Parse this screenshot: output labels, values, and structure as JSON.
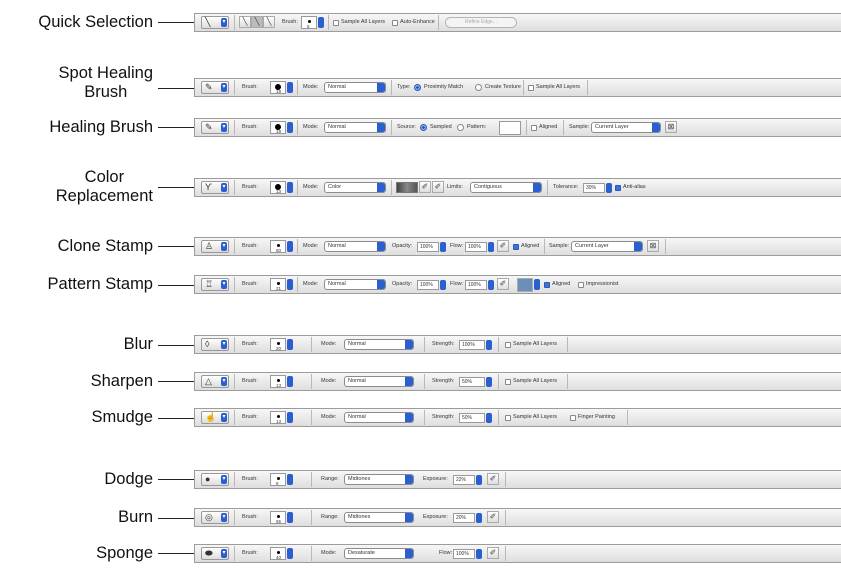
{
  "labels": {
    "quick_selection": "Quick Selection",
    "spot_healing": [
      "Spot Healing",
      "Brush"
    ],
    "healing_brush": "Healing Brush",
    "color_replacement": [
      "Color",
      "Replacement"
    ],
    "clone_stamp": "Clone Stamp",
    "pattern_stamp": "Pattern Stamp",
    "blur": "Blur",
    "sharpen": "Sharpen",
    "smudge": "Smudge",
    "dodge": "Dodge",
    "burn": "Burn",
    "sponge": "Sponge"
  },
  "common": {
    "brush_label": "Brush:",
    "mode_label": "Mode:",
    "sample_all_layers": "Sample All Layers",
    "aligned": "Aligned",
    "sample_label": "Sample:",
    "current_layer": "Current Layer",
    "normal": "Normal"
  },
  "quick_selection": {
    "brush_size": "5",
    "auto_enhance": "Auto-Enhance",
    "refine_edge": "Refine Edge..."
  },
  "spot_healing": {
    "brush_size": "19",
    "type_label": "Type:",
    "proximity_match": "Proximity Match",
    "create_texture": "Create Texture"
  },
  "healing_brush": {
    "brush_size": "19",
    "source_label": "Source:",
    "sampled": "Sampled",
    "pattern": "Pattern:"
  },
  "color_replacement": {
    "brush_size": "13",
    "mode_value": "Color",
    "limits_label": "Limits:",
    "limits_value": "Contiguous",
    "tolerance_label": "Tolerance:",
    "tolerance_value": "30%",
    "anti_alias": "Anti-alias"
  },
  "clone_stamp": {
    "brush_size": "60",
    "opacity_label": "Opacity:",
    "opacity_value": "100%",
    "flow_label": "Flow:",
    "flow_value": "100%"
  },
  "pattern_stamp": {
    "brush_size": "21",
    "opacity_value": "100%",
    "flow_value": "100%",
    "impressionist": "Impressionist"
  },
  "blur": {
    "brush_size": "20",
    "strength_label": "Strength:",
    "strength_value": "100%"
  },
  "sharpen": {
    "brush_size": "13",
    "strength_value": "50%"
  },
  "smudge": {
    "brush_size": "13",
    "strength_value": "50%",
    "finger_painting": "Finger Painting"
  },
  "dodge": {
    "brush_size": "8",
    "range_label": "Range:",
    "range_value": "Midtones",
    "exposure_label": "Exposure:",
    "exposure_value": "22%"
  },
  "burn": {
    "brush_size": "65",
    "range_value": "Midtones",
    "exposure_value": "20%"
  },
  "sponge": {
    "brush_size": "40",
    "mode_value": "Desaturate",
    "flow_label": "Flow:",
    "flow_value": "100%"
  },
  "icons": {
    "quick_selection": "quick-selection-icon",
    "spot_healing": "spot-healing-icon",
    "healing_brush": "healing-brush-icon",
    "color_replacement": "color-replacement-icon",
    "clone_stamp": "clone-stamp-icon",
    "pattern_stamp": "pattern-stamp-icon",
    "blur": "blur-icon",
    "sharpen": "sharpen-icon",
    "smudge": "smudge-icon",
    "dodge": "dodge-icon",
    "burn": "burn-icon",
    "sponge": "sponge-icon"
  }
}
